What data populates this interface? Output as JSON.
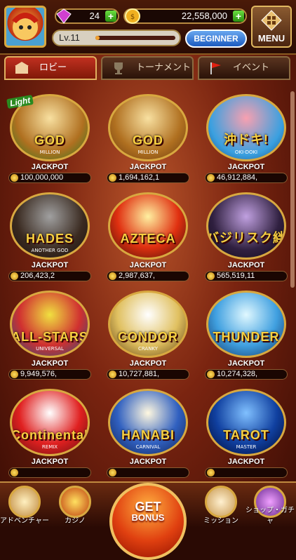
{
  "status": {
    "gems": "24",
    "coins": "22,558,000",
    "level": "Lv.11",
    "level_progress": 0.05,
    "rank_button": "BEGINNER",
    "menu_label": "MENU"
  },
  "tabs": [
    {
      "label": "ロビー",
      "icon": "lobby-icon",
      "active": true
    },
    {
      "label": "トーナメント",
      "icon": "trophy-icon",
      "active": false
    },
    {
      "label": "イベント",
      "icon": "flag-icon",
      "active": false
    }
  ],
  "games": [
    {
      "title": "GOD",
      "subtitle": "MILLION",
      "badge": "Light",
      "jackpot_label": "JACKPOT",
      "jackpot": "100,000,000"
    },
    {
      "title": "GOD",
      "subtitle": "MILLION",
      "jackpot_label": "JACKPOT",
      "jackpot": "1,694,162,1"
    },
    {
      "title": "沖ドキ!",
      "subtitle": "OKI-DOKI",
      "jackpot_label": "JACKPOT",
      "jackpot": "46,912,884,"
    },
    {
      "title": "HADES",
      "subtitle": "ANOTHER GOD",
      "jackpot_label": "JACKPOT",
      "jackpot": "206,423,2"
    },
    {
      "title": "AZTECA",
      "subtitle": "",
      "jackpot_label": "JACKPOT",
      "jackpot": "2,987,637,"
    },
    {
      "title": "バジリスク絆",
      "subtitle": "",
      "jackpot_label": "JACKPOT",
      "jackpot": "565,519,11"
    },
    {
      "title": "ALL-STARS",
      "subtitle": "UNIVERSAL",
      "jackpot_label": "JACKPOT",
      "jackpot": "9,949,576,"
    },
    {
      "title": "CONDOR",
      "subtitle": "CRANKY",
      "jackpot_label": "JACKPOT",
      "jackpot": "10,727,881,"
    },
    {
      "title": "THUNDER",
      "subtitle": "",
      "jackpot_label": "JACKPOT",
      "jackpot": "10,274,328,"
    },
    {
      "title": "Continental",
      "subtitle": "REMIX",
      "jackpot_label": "JACKPOT",
      "jackpot": ""
    },
    {
      "title": "HANABI",
      "subtitle": "CARNIVAL",
      "jackpot_label": "JACKPOT",
      "jackpot": ""
    },
    {
      "title": "TAROT",
      "subtitle": "MASTER",
      "jackpot_label": "JACKPOT",
      "jackpot": ""
    }
  ],
  "bottom_nav": [
    {
      "label": "アドベンチャー",
      "icon": "compass-icon"
    },
    {
      "label": "カジノ",
      "icon": "slot-machine-icon"
    },
    {
      "label": "ミッション",
      "icon": "scroll-icon"
    },
    {
      "label": "ショップ・ガチャ",
      "icon": "shop-icon"
    }
  ],
  "get_bonus": {
    "line1": "GET",
    "line2": "BONUS"
  },
  "colors": {
    "accent_gold": "#d8a840",
    "tab_active": "#c03020",
    "plus_green": "#4ac020"
  }
}
